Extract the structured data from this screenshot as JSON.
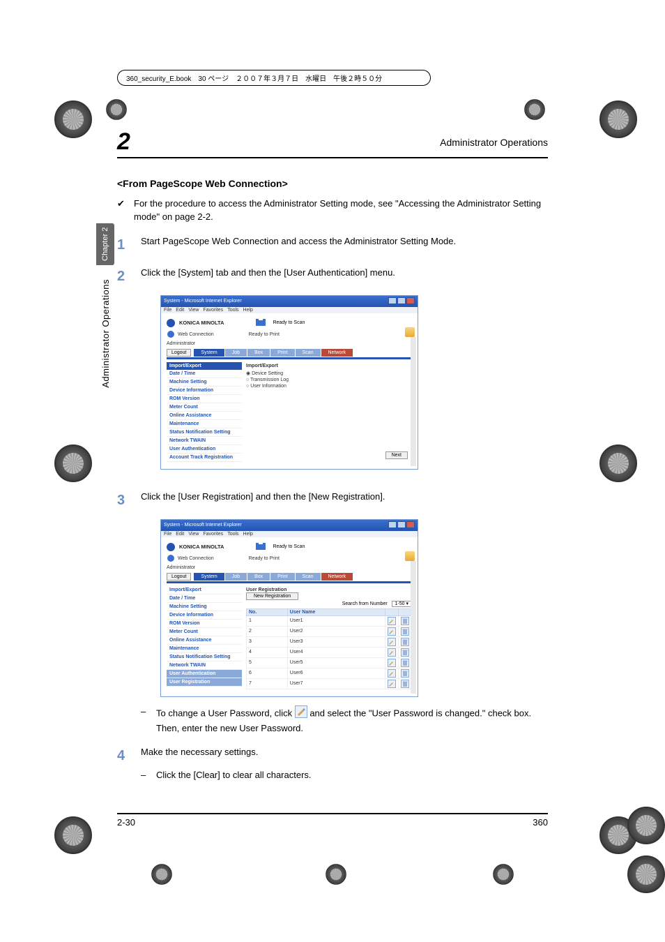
{
  "meta_line": "360_security_E.book　30 ページ　２００７年３月７日　水曜日　午後２時５０分",
  "header": {
    "chapter_num": "2",
    "title": "Administrator Operations"
  },
  "side": {
    "tab": "Chapter 2",
    "label": "Administrator Operations"
  },
  "section_heading": "<From PageScope Web Connection>",
  "check_text": "For the procedure to access the Administrator Setting mode, see \"Accessing the Administrator Setting mode\" on page 2-2.",
  "steps": {
    "s1": {
      "num": "1",
      "text": "Start PageScope Web Connection and access the Administrator Setting Mode."
    },
    "s2": {
      "num": "2",
      "text": "Click the [System] tab and then the [User Authentication] menu."
    },
    "s3": {
      "num": "3",
      "text": "Click the [User Registration] and then the [New Registration]."
    },
    "s3_sub_a": "To change a User Password, click ",
    "s3_sub_b": " and select the \"User Password is changed.\" check box. Then, enter the new User Password.",
    "s4": {
      "num": "4",
      "text": "Make the necessary settings."
    },
    "s4_sub": "Click the [Clear] to clear all characters."
  },
  "shot1": {
    "title": "System - Microsoft Internet Explorer",
    "menubar": [
      "File",
      "Edit",
      "View",
      "Favorites",
      "Tools",
      "Help"
    ],
    "km": "KONICA MINOLTA",
    "conn": "Web Connection",
    "ready_scan": "Ready to Scan",
    "ready_print": "Ready to Print",
    "admin": "Administrator",
    "logout": "Logout",
    "tabs": [
      "System",
      "Job",
      "Box",
      "Print",
      "Scan",
      "Network"
    ],
    "side_head": "Import/Export",
    "side_items": [
      "Date / Time",
      "Machine Setting",
      "Device Information",
      "ROM Version",
      "Meter Count",
      "Online Assistance",
      "Maintenance",
      "Status Notification Setting",
      "Network TWAIN",
      "User Authentication",
      "Account Track Registration"
    ],
    "main_head": "Import/Export",
    "radios": [
      "Device Setting",
      "Transmission Log",
      "User Information"
    ],
    "next": "Next"
  },
  "shot2": {
    "title": "System - Microsoft Internet Explorer",
    "menubar": [
      "File",
      "Edit",
      "View",
      "Favorites",
      "Tools",
      "Help"
    ],
    "km": "KONICA MINOLTA",
    "conn": "Web Connection",
    "ready_scan": "Ready to Scan",
    "ready_print": "Ready to Print",
    "admin": "Administrator",
    "logout": "Logout",
    "tabs": [
      "System",
      "Job",
      "Box",
      "Print",
      "Scan",
      "Network"
    ],
    "side_items": [
      "Import/Export",
      "Date / Time",
      "Machine Setting",
      "Device Information",
      "ROM Version",
      "Meter Count",
      "Online Assistance",
      "Maintenance",
      "Status Notification Setting",
      "Network TWAIN",
      "User Authentication",
      "User Registration"
    ],
    "main_head": "User Registration",
    "new_reg": "New Registration",
    "search_label": "Search from Number",
    "range": "1-50",
    "th_no": "No.",
    "th_user": "User Name",
    "rows": [
      {
        "no": "1",
        "name": "User1"
      },
      {
        "no": "2",
        "name": "User2"
      },
      {
        "no": "3",
        "name": "User3"
      },
      {
        "no": "4",
        "name": "User4"
      },
      {
        "no": "5",
        "name": "User5"
      },
      {
        "no": "6",
        "name": "User6"
      },
      {
        "no": "7",
        "name": "User7"
      }
    ]
  },
  "footer": {
    "left": "2-30",
    "right": "360"
  }
}
